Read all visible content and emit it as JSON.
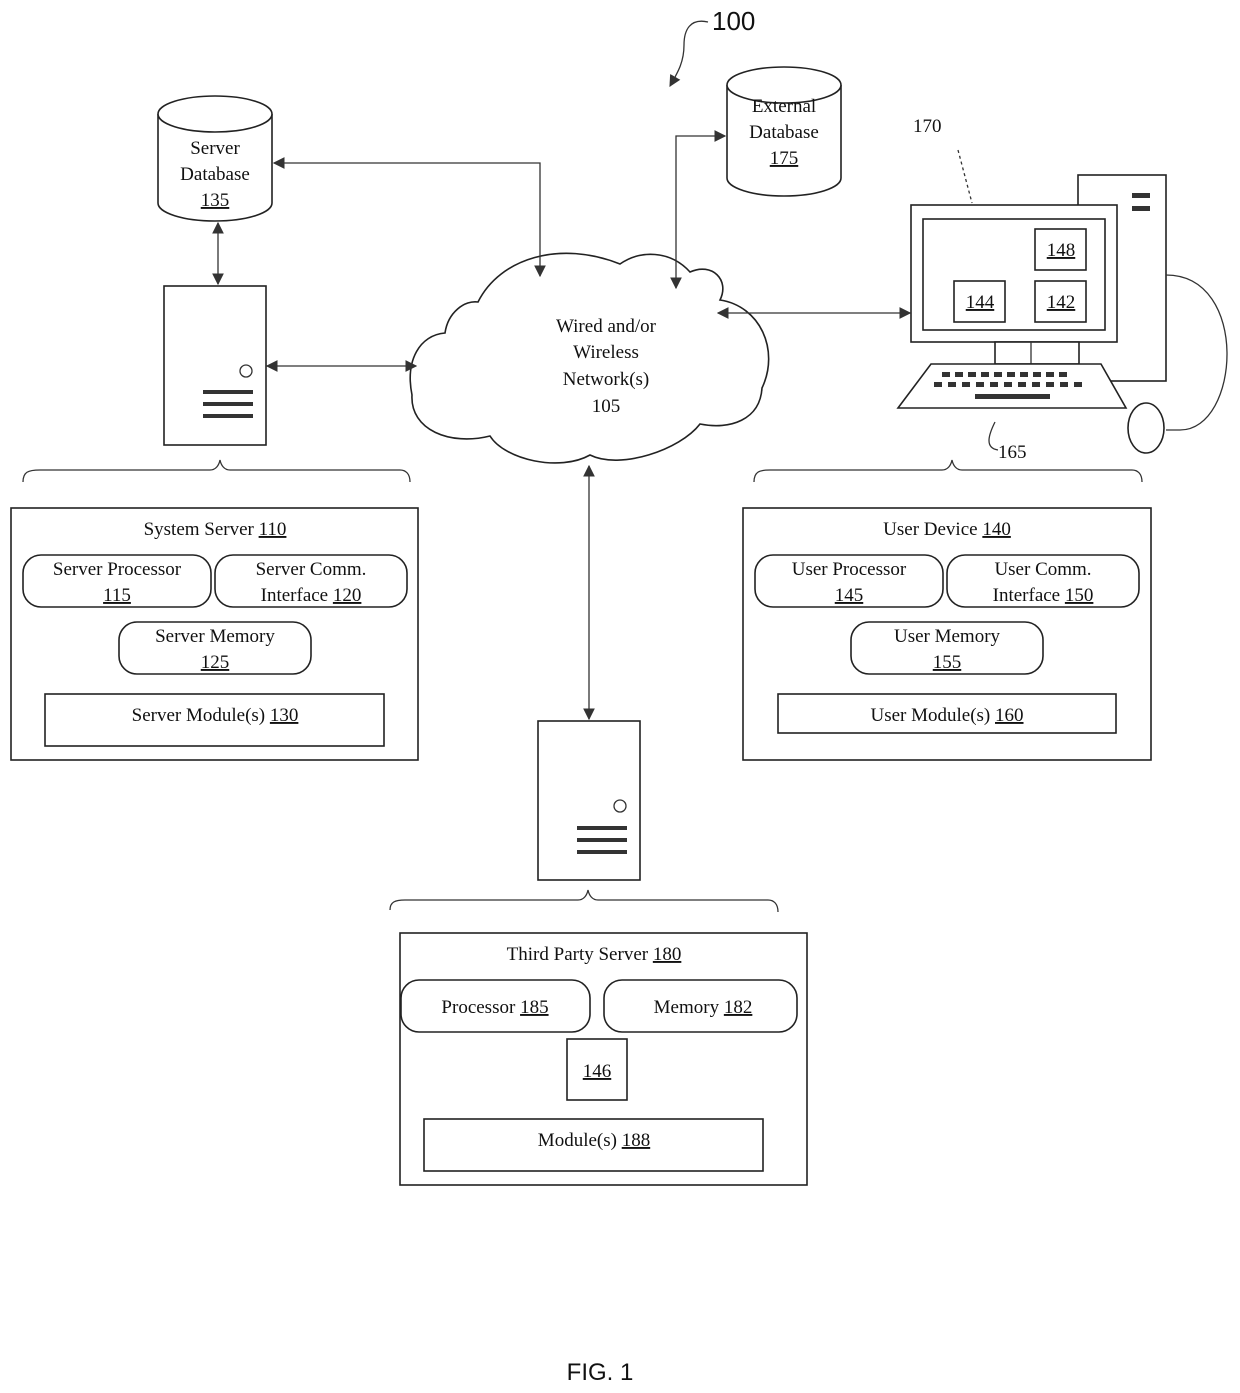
{
  "figure": {
    "ref": "100",
    "caption": "FIG. 1"
  },
  "network": {
    "lines": [
      "Wired and/or",
      "Wireless",
      "Network(s)",
      "105"
    ]
  },
  "server_database": {
    "line1": "Server",
    "line2": "Database",
    "ref": "135"
  },
  "external_database": {
    "line1": "External",
    "line2": "Database",
    "ref": "175"
  },
  "user_computer": {
    "ref_display": "170",
    "ref_keyboard": "165",
    "screen_items": [
      "148",
      "144",
      "142"
    ]
  },
  "system_server": {
    "title": "System Server",
    "ref": "110",
    "processor": {
      "line1": "Server Processor",
      "ref": "115"
    },
    "comm": {
      "line1": "Server Comm.",
      "line2": "Interface",
      "ref": "120"
    },
    "memory": {
      "line1": "Server Memory",
      "ref": "125"
    },
    "modules": {
      "label": "Server Module(s)",
      "ref": "130"
    }
  },
  "user_device": {
    "title": "User Device",
    "ref": "140",
    "processor": {
      "line1": "User Processor",
      "ref": "145"
    },
    "comm": {
      "line1": "User Comm.",
      "line2": "Interface",
      "ref": "150"
    },
    "memory": {
      "line1": "User Memory",
      "ref": "155"
    },
    "modules": {
      "label": "User Module(s)",
      "ref": "160"
    }
  },
  "third_party_server": {
    "title": "Third Party Server",
    "ref": "180",
    "processor": {
      "label": "Processor",
      "ref": "185"
    },
    "memory": {
      "label": "Memory",
      "ref": "182"
    },
    "component": {
      "ref": "146"
    },
    "modules": {
      "label": "Module(s)",
      "ref": "188"
    }
  }
}
